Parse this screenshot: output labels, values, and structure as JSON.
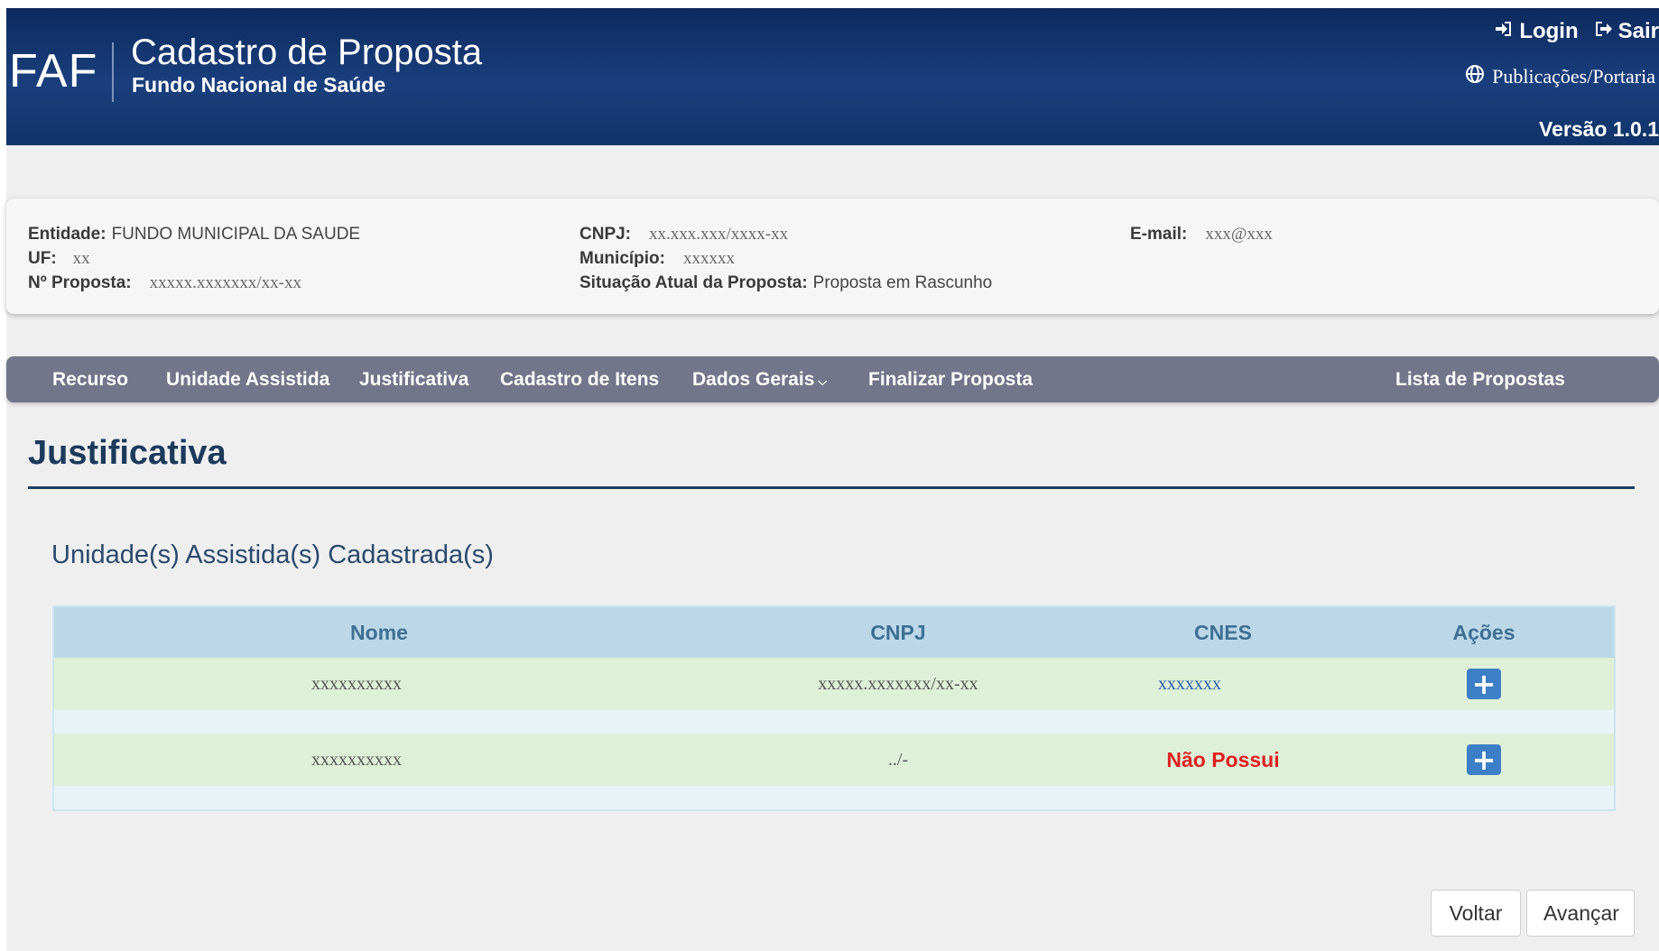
{
  "header": {
    "logo": "FAF",
    "title": "Cadastro de Proposta",
    "subtitle": "Fundo Nacional de Saúde",
    "login_label": "Login",
    "logout_label": "Sair",
    "publications_label": "Publicações/Portaria",
    "version": "Versão 1.0.1"
  },
  "info": {
    "entity_label": "Entidade:",
    "entity_value": "FUNDO MUNICIPAL DA SAUDE",
    "uf_label": "UF:",
    "uf_value": "xx",
    "proposal_label": "Nº Proposta:",
    "proposal_value": "xxxxx.xxxxxxx/xx-xx",
    "cnpj_label": "CNPJ:",
    "cnpj_value": "xx.xxx.xxx/xxxx-xx",
    "city_label": "Município:",
    "city_value": "xxxxxx",
    "status_label": "Situação Atual da Proposta:",
    "status_value": "Proposta em Rascunho",
    "email_label": "E-mail:",
    "email_value": "xxx@xxx"
  },
  "nav": {
    "items": [
      "Recurso",
      "Unidade Assistida",
      "Justificativa",
      "Cadastro de Itens",
      "Dados Gerais",
      "Finalizar Proposta"
    ],
    "right_item": "Lista de Propostas"
  },
  "page": {
    "title": "Justificativa",
    "section_title": "Unidade(s) Assistida(s) Cadastrada(s)"
  },
  "table": {
    "columns": [
      "Nome",
      "CNPJ",
      "CNES",
      "Ações"
    ],
    "rows": [
      {
        "nome": "xxxxxxxxxx",
        "cnpj": "xxxxx.xxxxxxx/xx-xx",
        "cnes": "xxxxxxx"
      },
      {
        "nome": "xxxxxxxxxx",
        "cnpj": "../-",
        "cnes": "Não Possui"
      }
    ]
  },
  "buttons": {
    "back": "Voltar",
    "next": "Avançar"
  },
  "colors": {
    "header_bg": "#1a3f7d",
    "nav_bg": "#73758a",
    "row_bg": "#dff0d8",
    "table_header_bg": "#bcd8e8",
    "no_cnes": "#e02020",
    "add_button": "#3c7fc6"
  },
  "icons": [
    "login-icon",
    "logout-icon",
    "globe-icon",
    "chevron-down-icon",
    "plus-icon"
  ]
}
